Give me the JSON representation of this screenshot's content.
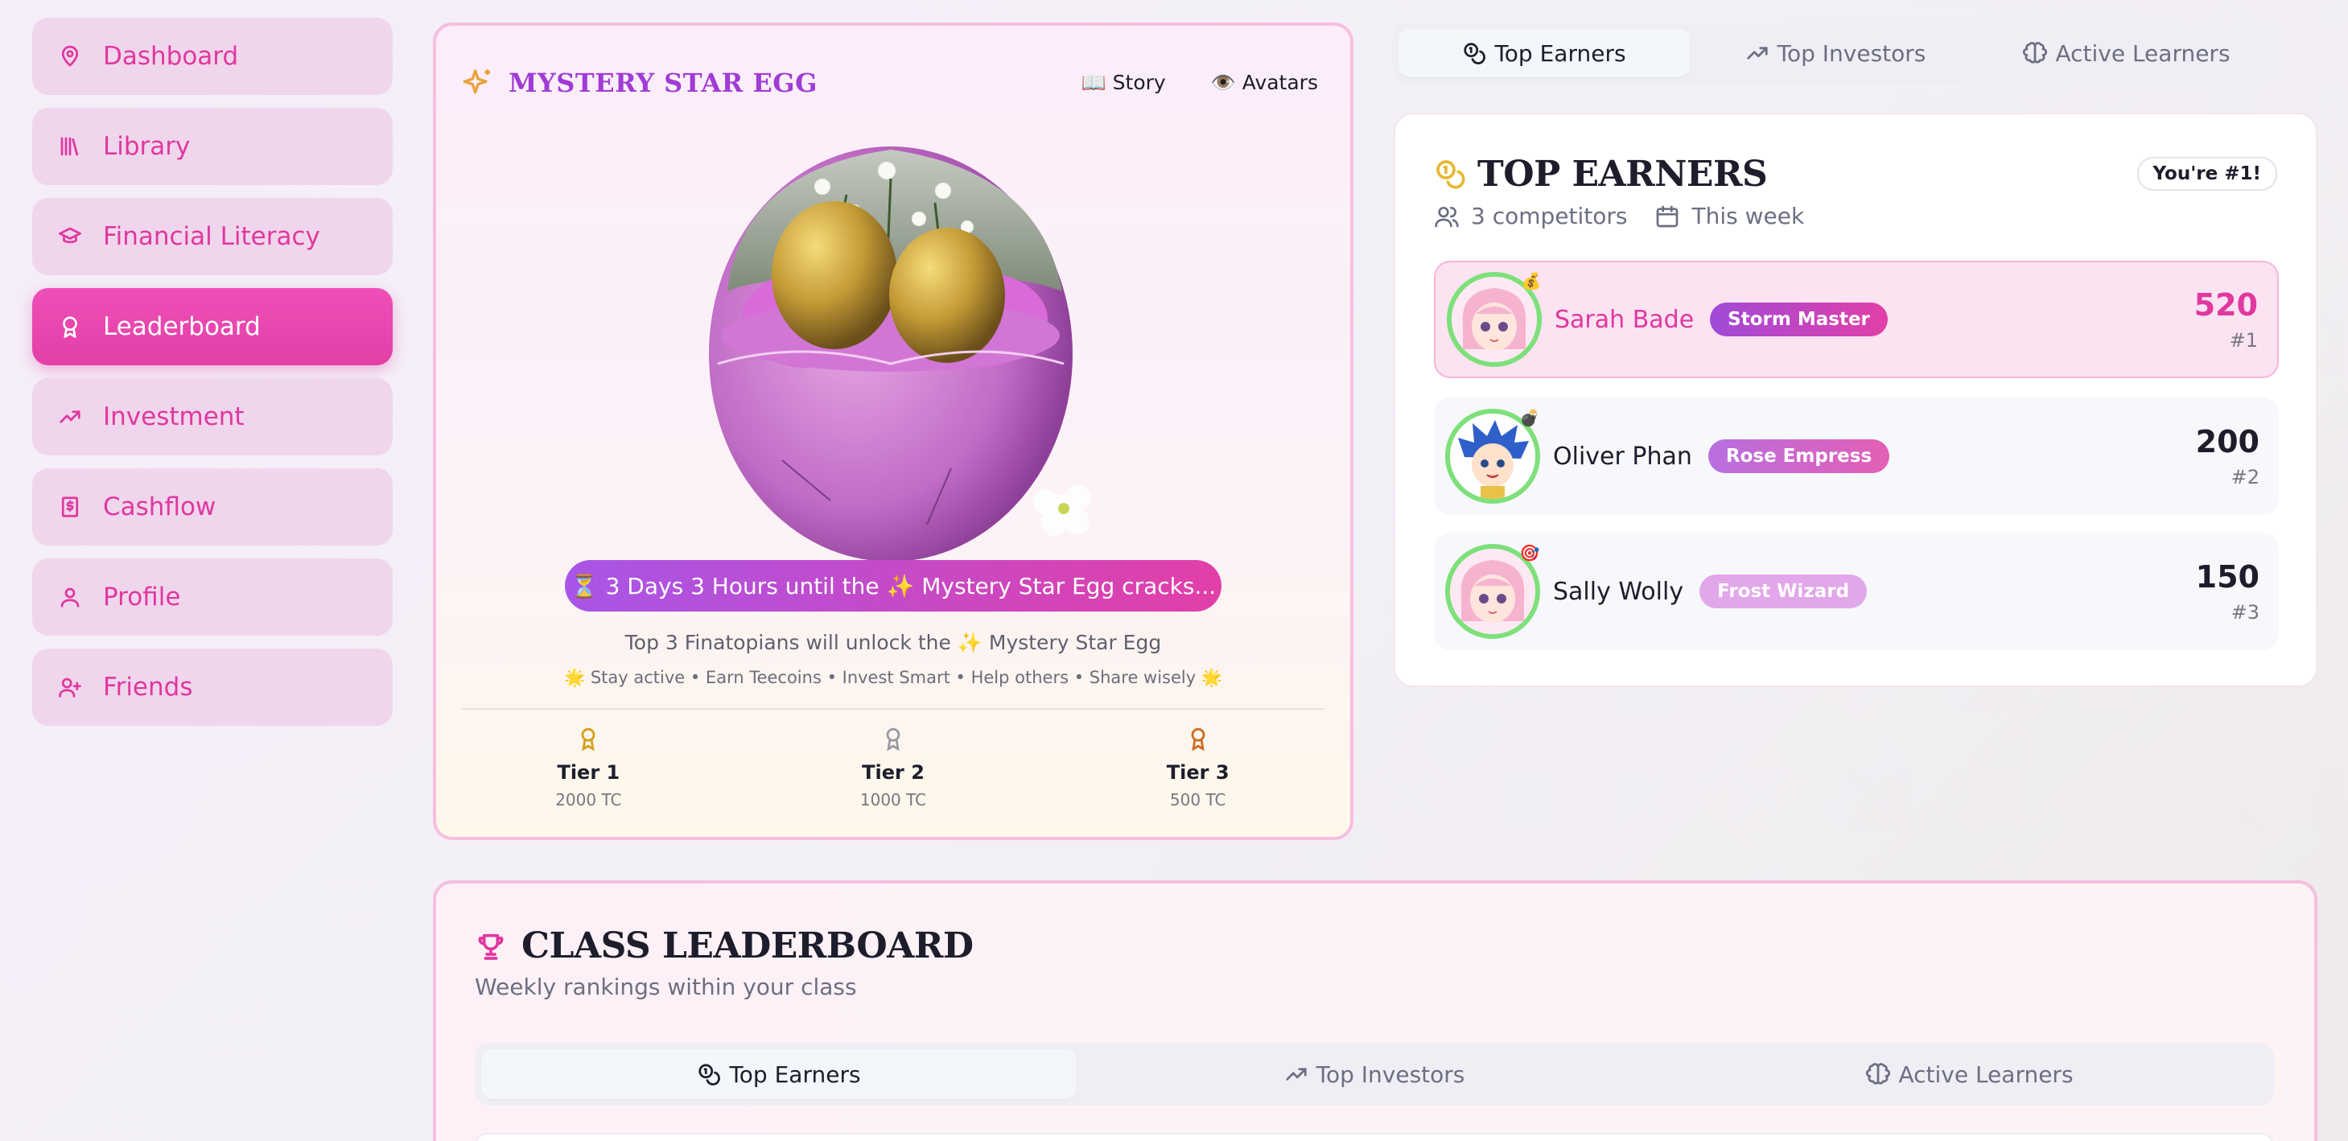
{
  "sidebar": {
    "items": [
      {
        "label": "Dashboard",
        "icon": "map-pin-icon",
        "active": false
      },
      {
        "label": "Library",
        "icon": "library-icon",
        "active": false
      },
      {
        "label": "Financial Literacy",
        "icon": "graduation-cap-icon",
        "active": false
      },
      {
        "label": "Leaderboard",
        "icon": "award-icon",
        "active": true
      },
      {
        "label": "Investment",
        "icon": "trending-up-icon",
        "active": false
      },
      {
        "label": "Cashflow",
        "icon": "receipt-icon",
        "active": false
      },
      {
        "label": "Profile",
        "icon": "user-icon",
        "active": false
      },
      {
        "label": "Friends",
        "icon": "user-plus-icon",
        "active": false
      }
    ]
  },
  "mystery_egg": {
    "title": "MYSTERY STAR EGG",
    "links": {
      "story": "📖 Story",
      "avatars": "👁️ Avatars"
    },
    "countdown": "⏳ 3 Days 3 Hours until the ✨ Mystery Star Egg cracks...",
    "unlock_text": "Top 3 Finatopians will unlock the ✨ Mystery Star Egg",
    "tips": "🌟 Stay active • Earn Teecoins • Invest Smart • Help others • Share wisely 🌟",
    "tiers": [
      {
        "name": "Tier 1",
        "amount": "2000 TC",
        "color": "#d4a017"
      },
      {
        "name": "Tier 2",
        "amount": "1000 TC",
        "color": "#9a9aa6"
      },
      {
        "name": "Tier 3",
        "amount": "500 TC",
        "color": "#d2691e"
      }
    ]
  },
  "top_tabs": [
    {
      "label": "Top Earners",
      "icon": "coins-icon",
      "active": true
    },
    {
      "label": "Top Investors",
      "icon": "trending-up-icon",
      "active": false
    },
    {
      "label": "Active Learners",
      "icon": "brain-icon",
      "active": false
    }
  ],
  "top_earners": {
    "title": "TOP EARNERS",
    "badge": "You're #1!",
    "competitors": "3 competitors",
    "period": "This week",
    "entries": [
      {
        "name": "Sarah Bade",
        "title": "Storm Master",
        "title_color": "#c43cc8",
        "score": "520",
        "rank": "#1",
        "badge_emoji": "💰"
      },
      {
        "name": "Oliver Phan",
        "title": "Rose Empress",
        "title_color": "#c86fd6",
        "score": "200",
        "rank": "#2",
        "badge_emoji": "💣"
      },
      {
        "name": "Sally Wolly",
        "title": "Frost Wizard",
        "title_color": "#e2a6ea",
        "score": "150",
        "rank": "#3",
        "badge_emoji": "🎯"
      }
    ]
  },
  "class_leaderboard": {
    "title": "CLASS LEADERBOARD",
    "subtitle": "Weekly rankings within your class",
    "tabs": [
      {
        "label": "Top Earners",
        "icon": "coins-icon",
        "active": true
      },
      {
        "label": "Top Investors",
        "icon": "trending-up-icon",
        "active": false
      },
      {
        "label": "Active Learners",
        "icon": "brain-icon",
        "active": false
      }
    ]
  },
  "colors": {
    "accent_pink": "#e0389f",
    "accent_purple": "#a03bd6",
    "avatar_ring": "#7ee07a"
  }
}
